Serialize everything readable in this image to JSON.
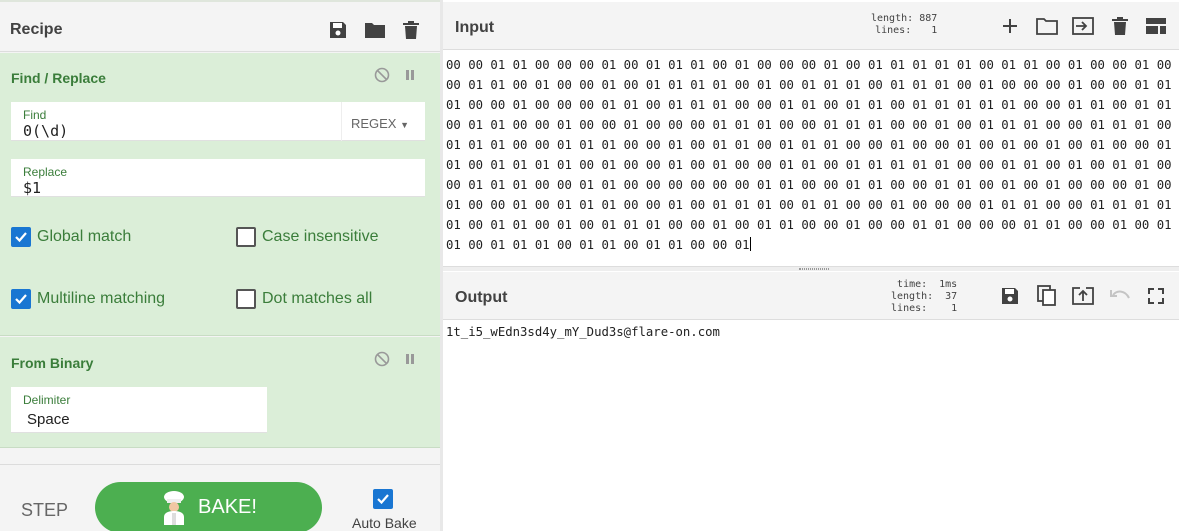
{
  "recipe": {
    "title": "Recipe",
    "operations": [
      {
        "name": "Find / Replace",
        "find_label": "Find",
        "find_value": "0(\\d)",
        "find_mode": "REGEX",
        "replace_label": "Replace",
        "replace_value": "$1",
        "options": [
          {
            "label": "Global match",
            "checked": true
          },
          {
            "label": "Case insensitive",
            "checked": false
          },
          {
            "label": "Multiline matching",
            "checked": true
          },
          {
            "label": "Dot matches all",
            "checked": false
          }
        ]
      },
      {
        "name": "From Binary",
        "delimiter_label": "Delimiter",
        "delimiter_value": "Space"
      }
    ],
    "step_label": "STEP",
    "bake_label": "BAKE!",
    "auto_bake_label": "Auto Bake",
    "auto_bake_checked": true
  },
  "input": {
    "title": "Input",
    "length_label": "length:",
    "length_value": "887",
    "lines_label": "lines:",
    "lines_value": "1",
    "text": "00 00 01 01 00 00 00 01 00 01 01 01 00 01 00 00 00 01 00 01 01 01 01 01 00 01 01 00 01 00 00 01 00 00 01 01 00 01 00 00 01 00 01 01 01 01 00 01 00 01 01 01 00 01 01 01 00 01 00 00 00 01 00 00 01 01 01 00 00 01 00 00 00 01 01 00 01 01 01 00 00 01 01 00 01 01 00 01 01 01 01 01 00 00 01 01 00 01 01 00 01 01 00 00 01 00 00 01 00 00 00 01 01 01 00 00 01 01 01 00 00 01 00 01 01 01 00 00 01 01 01 00 01 01 01 00 00 01 01 01 00 00 01 00 01 01 00 01 01 01 00 00 01 00 00 01 00 01 00 01 00 01 00 00 01 01 00 01 01 01 01 00 01 00 00 01 00 01 00 00 01 01 00 01 01 01 01 01 00 00 01 01 00 01 00 01 01 00 00 01 01 01 00 00 01 01 00 00 00 00 00 00 01 01 00 00 01 01 00 00 01 01 00 01 00 01 00 00 00 01 00 01 00 00 01 00 01 01 01 00 00 01 00 01 01 01 00 01 01 00 00 01 00 00 00 01 01 01 00 00 01 01 01 01 01 00 01 01 00 01 00 01 01 01 00 00 01 00 01 01 00 00 01 00 00 01 01 00 00 00 01 01 00 00 01 00 01 01 00 01 01 01 00 01 01 00 01 01 00 00 01",
    "icons": [
      "plus-icon",
      "folder-icon",
      "import-icon",
      "trash-icon",
      "layout-icon"
    ]
  },
  "output": {
    "title": "Output",
    "time_label": "time:",
    "time_value": "1ms",
    "length_label": "length:",
    "length_value": "37",
    "lines_label": "lines:",
    "lines_value": "1",
    "text": "1t_i5_wEdn3sd4y_mY_Dud3s@flare-on.com",
    "icons": [
      "save-icon",
      "copy-icon",
      "replace-input-icon",
      "undo-icon",
      "fullscreen-icon"
    ]
  },
  "colors": {
    "accent_green": "#4caf50",
    "operation_bg": "#dbeed8",
    "operation_text": "#3a7d3a",
    "checkbox_blue": "#1976d2"
  }
}
